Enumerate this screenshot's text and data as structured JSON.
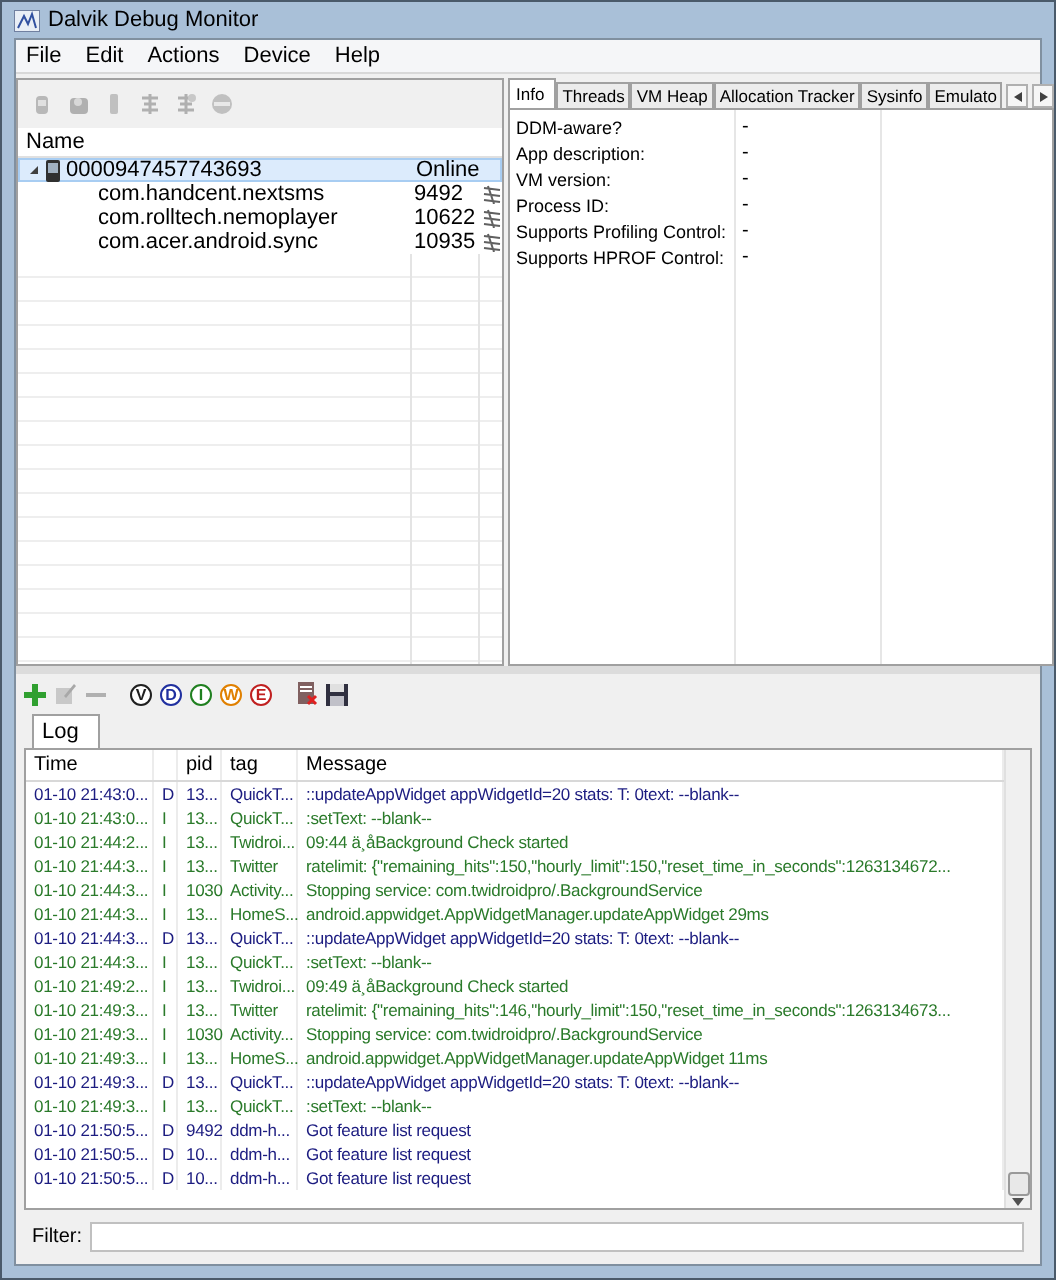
{
  "window": {
    "title": "Dalvik Debug Monitor"
  },
  "menu": [
    "File",
    "Edit",
    "Actions",
    "Device",
    "Help"
  ],
  "devices": {
    "column": "Name",
    "items": [
      {
        "name": "0000947457743693",
        "status": "Online",
        "expanded": true,
        "selected": true,
        "children": [
          {
            "name": "com.handcent.nextsms",
            "pid": "9492"
          },
          {
            "name": "com.rolltech.nemoplayer",
            "pid": "10622"
          },
          {
            "name": "com.acer.android.sync",
            "pid": "10935"
          }
        ]
      }
    ]
  },
  "tabs": [
    {
      "label": "Info",
      "selected": true
    },
    {
      "label": "Threads",
      "selected": false
    },
    {
      "label": "VM Heap",
      "selected": false
    },
    {
      "label": "Allocation Tracker",
      "selected": false
    },
    {
      "label": "Sysinfo",
      "selected": false
    },
    {
      "label": "Emulato",
      "selected": false
    }
  ],
  "info": [
    {
      "label": "DDM-aware?",
      "value": "-"
    },
    {
      "label": "App description:",
      "value": "-"
    },
    {
      "label": "VM version:",
      "value": "-"
    },
    {
      "label": "Process ID:",
      "value": "-"
    },
    {
      "label": "Supports Profiling Control:",
      "value": "-"
    },
    {
      "label": "Supports HPROF Control:",
      "value": "-"
    }
  ],
  "log_levels": [
    {
      "label": "V",
      "color": "#202020"
    },
    {
      "label": "D",
      "color": "#2030a0"
    },
    {
      "label": "I",
      "color": "#208020"
    },
    {
      "label": "W",
      "color": "#e08000"
    },
    {
      "label": "E",
      "color": "#c02020"
    }
  ],
  "log": {
    "tab": "Log",
    "columns": {
      "time": "Time",
      "pid": "pid",
      "tag": "tag",
      "message": "Message"
    },
    "rows": [
      {
        "kind": "debug",
        "time": "01-10 21:43:0...",
        "level": "D",
        "pid": "13...",
        "tag": "QuickT...",
        "message": "::updateAppWidget appWidgetId=20 stats: T: 0text: --blank--"
      },
      {
        "kind": "info",
        "time": "01-10 21:43:0...",
        "level": "I",
        "pid": "13...",
        "tag": "QuickT...",
        "message": ":setText: --blank--"
      },
      {
        "kind": "info",
        "time": "01-10 21:44:2...",
        "level": "I",
        "pid": "13...",
        "tag": "Twidroi...",
        "message": "09:44 ä¸åBackground Check started"
      },
      {
        "kind": "info",
        "time": "01-10 21:44:3...",
        "level": "I",
        "pid": "13...",
        "tag": "Twitter",
        "message": "ratelimit: {\"remaining_hits\":150,\"hourly_limit\":150,\"reset_time_in_seconds\":1263134672..."
      },
      {
        "kind": "info",
        "time": "01-10 21:44:3...",
        "level": "I",
        "pid": "1030",
        "tag": "Activity...",
        "message": "Stopping service: com.twidroidpro/.BackgroundService"
      },
      {
        "kind": "info",
        "time": "01-10 21:44:3...",
        "level": "I",
        "pid": "13...",
        "tag": "HomeS...",
        "message": "android.appwidget.AppWidgetManager.updateAppWidget 29ms"
      },
      {
        "kind": "debug",
        "time": "01-10 21:44:3...",
        "level": "D",
        "pid": "13...",
        "tag": "QuickT...",
        "message": "::updateAppWidget appWidgetId=20 stats: T: 0text: --blank--"
      },
      {
        "kind": "info",
        "time": "01-10 21:44:3...",
        "level": "I",
        "pid": "13...",
        "tag": "QuickT...",
        "message": ":setText: --blank--"
      },
      {
        "kind": "info",
        "time": "01-10 21:49:2...",
        "level": "I",
        "pid": "13...",
        "tag": "Twidroi...",
        "message": "09:49 ä¸åBackground Check started"
      },
      {
        "kind": "info",
        "time": "01-10 21:49:3...",
        "level": "I",
        "pid": "13...",
        "tag": "Twitter",
        "message": "ratelimit: {\"remaining_hits\":146,\"hourly_limit\":150,\"reset_time_in_seconds\":1263134673..."
      },
      {
        "kind": "info",
        "time": "01-10 21:49:3...",
        "level": "I",
        "pid": "1030",
        "tag": "Activity...",
        "message": "Stopping service: com.twidroidpro/.BackgroundService"
      },
      {
        "kind": "info",
        "time": "01-10 21:49:3...",
        "level": "I",
        "pid": "13...",
        "tag": "HomeS...",
        "message": "android.appwidget.AppWidgetManager.updateAppWidget 11ms"
      },
      {
        "kind": "debug",
        "time": "01-10 21:49:3...",
        "level": "D",
        "pid": "13...",
        "tag": "QuickT...",
        "message": "::updateAppWidget appWidgetId=20 stats: T: 0text: --blank--"
      },
      {
        "kind": "info",
        "time": "01-10 21:49:3...",
        "level": "I",
        "pid": "13...",
        "tag": "QuickT...",
        "message": ":setText: --blank--"
      },
      {
        "kind": "debug",
        "time": "01-10 21:50:5...",
        "level": "D",
        "pid": "9492",
        "tag": "ddm-h...",
        "message": "Got feature list request"
      },
      {
        "kind": "debug",
        "time": "01-10 21:50:5...",
        "level": "D",
        "pid": "10...",
        "tag": "ddm-h...",
        "message": "Got feature list request"
      },
      {
        "kind": "debug",
        "time": "01-10 21:50:5...",
        "level": "D",
        "pid": "10...",
        "tag": "ddm-h...",
        "message": "Got feature list request"
      }
    ]
  },
  "filter": {
    "label": "Filter:"
  }
}
